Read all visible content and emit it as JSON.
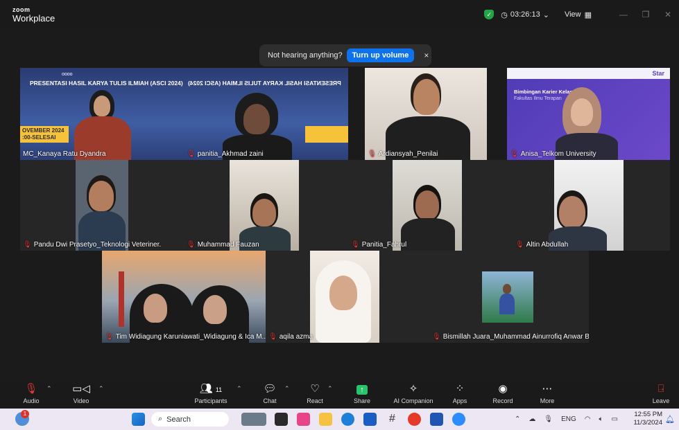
{
  "app": {
    "logo_small": "zoom",
    "logo_name": "Workplace"
  },
  "titlebar": {
    "timer": "03:26:13",
    "view_label": "View"
  },
  "notice": {
    "text": "Not hearing anything?",
    "button": "Turn up volume",
    "close": "×"
  },
  "banner": {
    "title": "PRESENTASI HASIL KARYA TULIS ILMIAH (ASCI 2024)",
    "dots": "oooo",
    "date_line": "OVEMBER 2024",
    "time_line": ":00-SELESAI"
  },
  "slide": {
    "brand": "Star",
    "title": "Bimbingan Karier Kelas",
    "subtitle": "Fakultas Ilmu Terapan"
  },
  "participants": [
    {
      "name": "MC_Kanaya Ratu Dyandra"
    },
    {
      "name": "panitia_Akhmad zaini"
    },
    {
      "name": "Ardiansyah_Penilai"
    },
    {
      "name": "Anisa_Telkom University"
    },
    {
      "name": "Pandu Dwi Prasetyo_Teknologi Veteriner."
    },
    {
      "name": "Muhammad Fauzan"
    },
    {
      "name": "Panitia_Fahrul"
    },
    {
      "name": "Altin Abdullah"
    },
    {
      "name": "Tim Widiagung Karuniawati_Widiagung & Ica M..."
    },
    {
      "name": "aqila azma"
    },
    {
      "name": "Bismillah Juara_Muhammad Ainurrofiq Anwar B..."
    }
  ],
  "toolbar": {
    "audio": "Audio",
    "video": "Video",
    "participants": "Participants",
    "participants_count": "11",
    "chat": "Chat",
    "react": "React",
    "share": "Share",
    "ai": "AI Companion",
    "apps": "Apps",
    "record": "Record",
    "more": "More",
    "leave": "Leave"
  },
  "taskbar": {
    "search": "Search",
    "lang": "ENG",
    "time": "12:55 PM",
    "date": "11/3/2024",
    "badge": "1"
  },
  "colors": {
    "accent": "#0e72ed",
    "speaker": "#26d07c",
    "muted": "#e53935"
  }
}
